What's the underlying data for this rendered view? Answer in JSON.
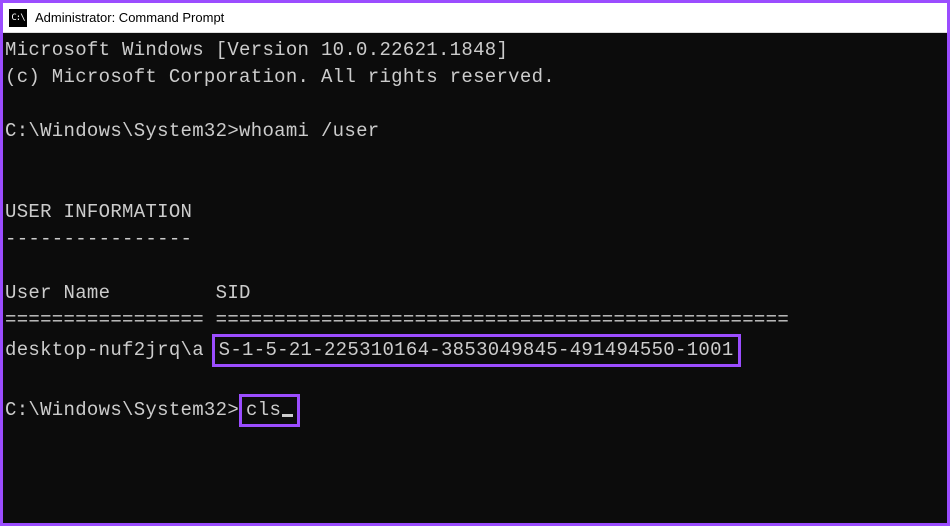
{
  "titlebar": {
    "icon_label": "C:\\",
    "title": "Administrator: Command Prompt"
  },
  "terminal": {
    "line_version": "Microsoft Windows [Version 10.0.22621.1848]",
    "line_copyright": "(c) Microsoft Corporation. All rights reserved.",
    "blank": "",
    "prompt1": "C:\\Windows\\System32>",
    "cmd1": "whoami /user",
    "section_header": "USER INFORMATION",
    "section_underline": "----------------",
    "col_user": "User Name",
    "col_sid": "SID",
    "col_user_pad": "        ",
    "divider_user": "=================",
    "divider_sid": "=================================================",
    "divider_gap": " ",
    "username": "desktop-nuf2jrq\\a",
    "username_gap": " ",
    "sid_value": "S-1-5-21-225310164-3853049845-491494550-1001",
    "prompt2": "C:\\Windows\\System32>",
    "cmd2": "cls"
  }
}
